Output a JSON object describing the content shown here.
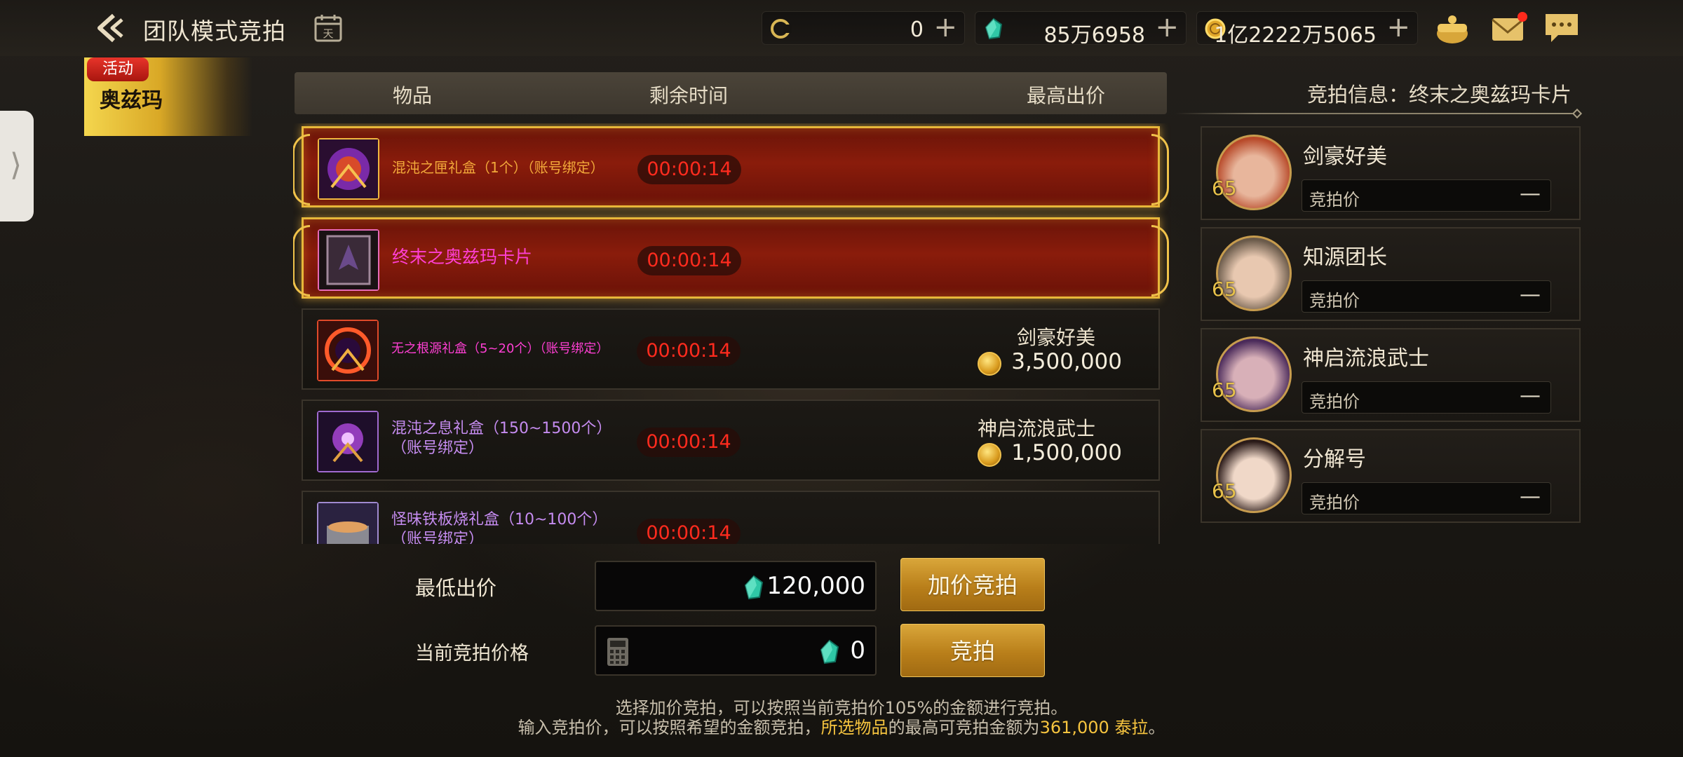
{
  "header": {
    "title": "团队模式竞拍",
    "currencies": [
      {
        "icon": "moon-coin-icon",
        "value": "0"
      },
      {
        "icon": "green-gem-icon",
        "value": "85万6958"
      },
      {
        "icon": "gold-coin-icon",
        "value": "1亿2222万5065"
      }
    ],
    "plus_label": "+"
  },
  "event": {
    "badge": "活动",
    "name": "奥兹玛"
  },
  "side_handle": "⟩",
  "list_header": {
    "item": "物品",
    "time": "剩余时间",
    "bid": "最高出价"
  },
  "items": [
    {
      "name": "混沌之匣礼盒（1个）（账号绑定）",
      "name_color": "#f2a93a",
      "time": "00:00:14",
      "bidder": "",
      "amount": "",
      "selected": true,
      "icon": "chaos-box-icon"
    },
    {
      "name": "终末之奥兹玛卡片",
      "name_color": "#ff3fd4",
      "time": "00:00:14",
      "bidder": "",
      "amount": "",
      "selected": true,
      "icon": "ozma-card-icon"
    },
    {
      "name": "无之根源礼盒（5~20个）（账号绑定）",
      "name_color": "#ff3fd4",
      "time": "00:00:14",
      "bidder": "剑豪好美",
      "amount": "3,500,000",
      "selected": false,
      "icon": "void-origin-box-icon"
    },
    {
      "name": "混沌之息礼盒（150~1500个）（账号绑定）",
      "name_color": "#c58cf0",
      "time": "00:00:14",
      "bidder": "神启流浪武士",
      "amount": "1,500,000",
      "selected": false,
      "icon": "chaos-breath-box-icon"
    },
    {
      "name": "怪味铁板烧礼盒（10~100个）（账号绑定）",
      "name_color": "#c58cf0",
      "time": "00:00:14",
      "bidder": "",
      "amount": "",
      "selected": false,
      "icon": "teppanyaki-box-icon"
    }
  ],
  "auction_info": {
    "title": "竞拍信息：终末之奥兹玛卡片"
  },
  "bidders": [
    {
      "name": "剑豪好美",
      "level": "65",
      "field": "竞拍价",
      "dash": "—",
      "colors": [
        "#e8b69c",
        "#b84a2a"
      ]
    },
    {
      "name": "知源团长",
      "level": "65",
      "field": "竞拍价",
      "dash": "—",
      "colors": [
        "#e8c8b0",
        "#6a5a4a"
      ]
    },
    {
      "name": "神启流浪武士",
      "level": "65",
      "field": "竞拍价",
      "dash": "—",
      "colors": [
        "#d8b0b8",
        "#4a2a5a"
      ]
    },
    {
      "name": "分解号",
      "level": "65",
      "field": "竞拍价",
      "dash": "—",
      "colors": [
        "#f0d8c8",
        "#2a1a18"
      ]
    }
  ],
  "bid_panel": {
    "min_label": "最低出价",
    "min_value": "120,000",
    "current_label": "当前竞拍价格",
    "current_value": "0",
    "raise_button": "加价竞拍",
    "bid_button": "竞拍"
  },
  "notice": {
    "line1": "选择加价竞拍，可以按照当前竞拍价105%的金额进行竞拍。",
    "line2_a": "输入竞拍价，可以按照希望的金额竞拍，",
    "line2_hl1": "所选物品",
    "line2_b": "的最高可竞拍金额为",
    "line2_hl2": "361,000 泰拉",
    "line2_c": "。"
  }
}
